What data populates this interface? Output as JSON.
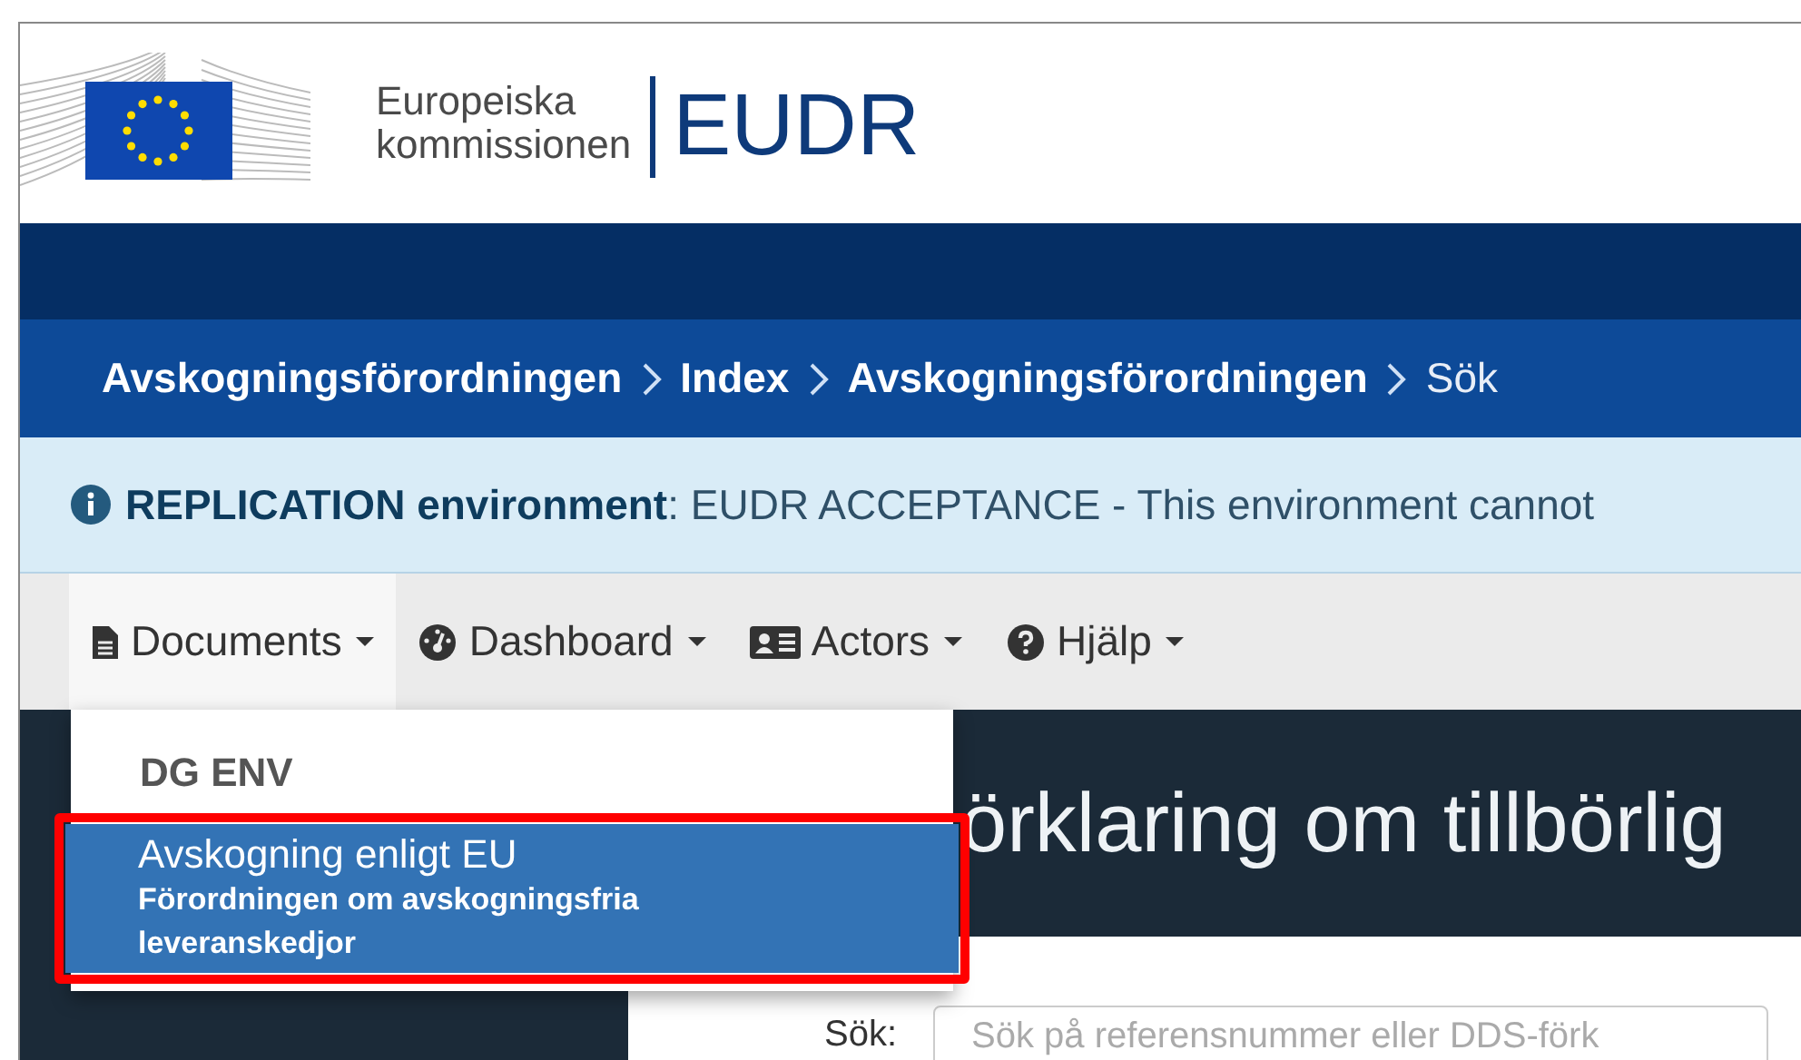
{
  "header": {
    "org_line1": "Europeiska",
    "org_line2": "kommissionen",
    "app_name": "EUDR"
  },
  "breadcrumbs": [
    {
      "label": "Avskogningsförordningen",
      "current": false
    },
    {
      "label": "Index",
      "current": false
    },
    {
      "label": "Avskogningsförordningen",
      "current": false
    },
    {
      "label": "Sök",
      "current": true
    }
  ],
  "banner": {
    "text": "**REPLICATION environment**: EUDR ACCEPTANCE - This environment cannot"
  },
  "nav": [
    {
      "label": "Documents",
      "selected": true
    },
    {
      "label": "Dashboard",
      "selected": false
    },
    {
      "label": "Actors",
      "selected": false
    },
    {
      "label": "Hjälp",
      "selected": false
    }
  ],
  "dropdown": {
    "group": "DG ENV",
    "items": [
      {
        "title": "Avskogning enligt EU",
        "subtitle": "Förordningen om avskogningsfria leveranskedjor",
        "selected": true,
        "highlighted": true
      }
    ]
  },
  "page": {
    "heading": "örklaring om tillbörlig",
    "search_label": "Sök:",
    "search_placeholder": "Sök på referensnummer eller DDS-förk"
  }
}
